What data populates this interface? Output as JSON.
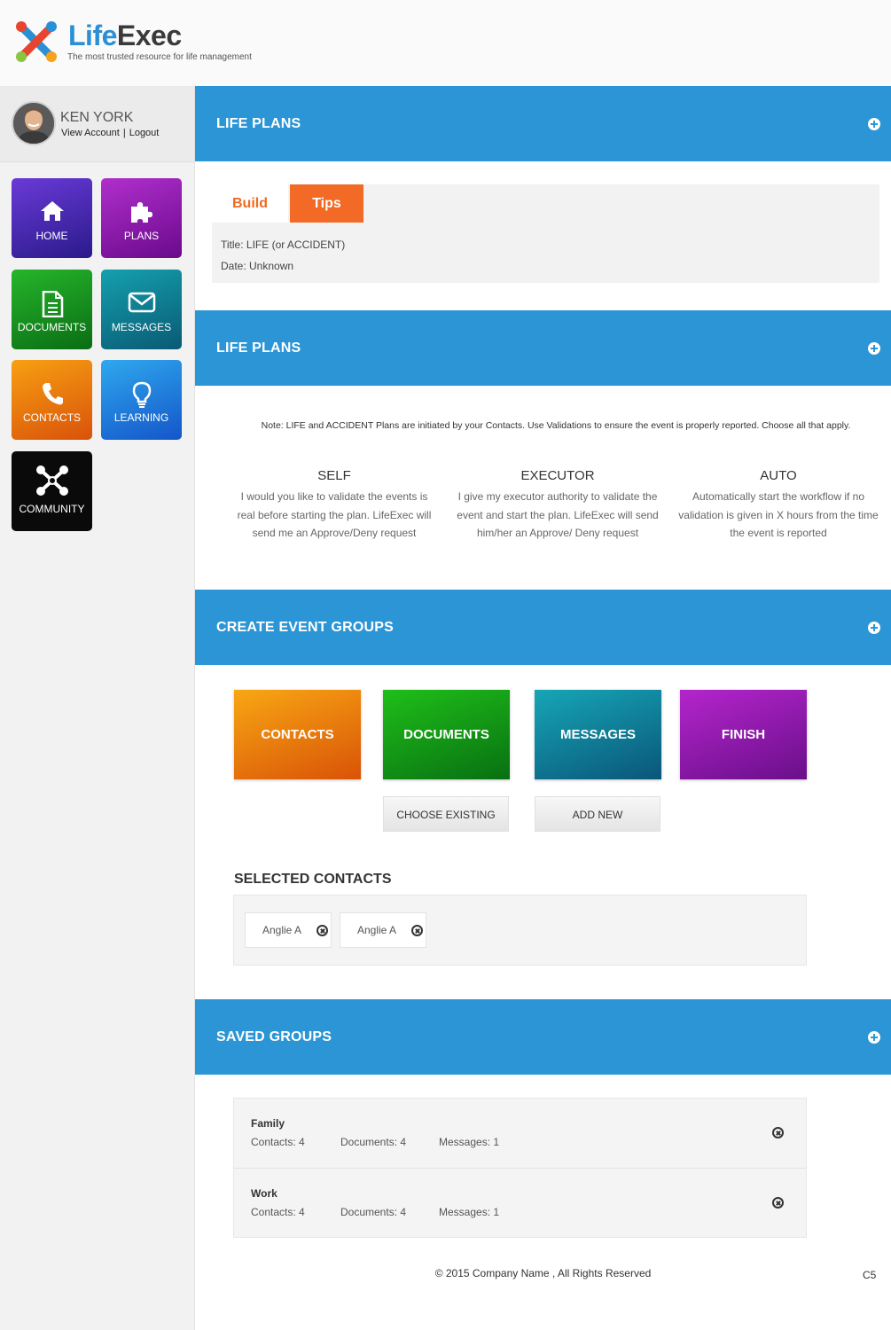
{
  "brand": {
    "name_part1": "Life",
    "name_part2": "Exec",
    "tagline": "The most trusted resource for life management"
  },
  "user": {
    "name": "KEN YORK",
    "view_account": "View Account",
    "separator": "|",
    "logout": "Logout"
  },
  "nav": {
    "home": "HOME",
    "plans": "PLANS",
    "documents": "DOCUMENTS",
    "messages": "MESSAGES",
    "contacts": "CONTACTS",
    "learning": "LEARNING",
    "community": "COMMUNITY"
  },
  "sections": {
    "life_plans_1": "LIFE PLANS",
    "life_plans_2": "LIFE PLANS",
    "create_event_groups": "CREATE EVENT GROUPS",
    "saved_groups": "SAVED GROUPS"
  },
  "tabs": {
    "build": "Build",
    "tips": "Tips",
    "title_line": "Title: LIFE (or ACCIDENT)",
    "date_line": "Date: Unknown"
  },
  "note": "Note: LIFE and ACCIDENT Plans are initiated by your Contacts. Use Validations to ensure the event is properly reported. Choose all that apply.",
  "options": [
    {
      "title": "SELF",
      "desc": "I would you like to validate the events is real before starting the plan. LifeExec will send me an Approve/Deny request"
    },
    {
      "title": "EXECUTOR",
      "desc": "I give my executor authority to validate the event and start the plan. LifeExec will send him/her an Approve/ Deny request"
    },
    {
      "title": "AUTO",
      "desc": "Automatically start the workflow if no validation is given in X hours from the time the event is reported"
    }
  ],
  "steps": {
    "contacts": "CONTACTS",
    "documents": "DOCUMENTS",
    "messages": "MESSAGES",
    "finish": "FINISH"
  },
  "actions": {
    "choose_existing": "CHOOSE EXISTING",
    "add_new": "ADD NEW"
  },
  "selected": {
    "title": "SELECTED CONTACTS",
    "chips": [
      "Anglie A",
      "Anglie A"
    ]
  },
  "groups": [
    {
      "name": "Family",
      "contacts": "Contacts: 4",
      "documents": "Documents: 4",
      "messages": "Messages: 1"
    },
    {
      "name": "Work",
      "contacts": "Contacts: 4",
      "documents": "Documents: 4",
      "messages": "Messages: 1"
    }
  ],
  "footer": {
    "copyright": "© 2015 Company Name , All Rights Reserved",
    "code": "C5"
  },
  "colors": {
    "accent_blue": "#2b95d6",
    "accent_orange": "#f26a25"
  }
}
